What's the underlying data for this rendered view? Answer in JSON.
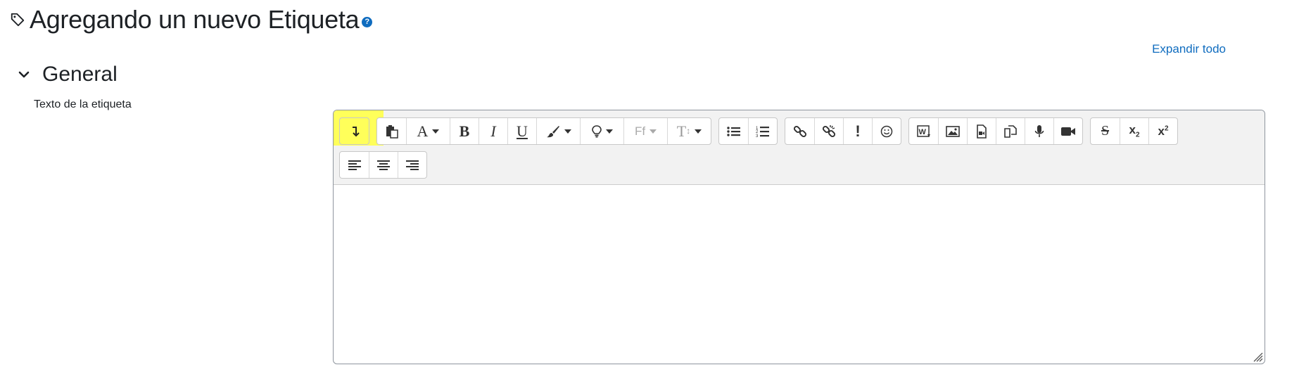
{
  "page": {
    "title": "Agregando un nuevo Etiqueta",
    "expand_all": "Expandir todo"
  },
  "section": {
    "title": "General"
  },
  "field": {
    "label": "Texto de la etiqueta",
    "value": ""
  },
  "toolbar": {
    "highlight_color": "#ffff5a",
    "row1": [
      {
        "name": "toolbar-toggle-button",
        "icon": "arrow-down-icon"
      },
      {
        "name": "paste-button",
        "icon": "clipboard-icon"
      },
      {
        "name": "font-family-button",
        "icon": "font-icon"
      },
      {
        "name": "bold-button",
        "icon": "bold-icon"
      },
      {
        "name": "italic-button",
        "icon": "italic-icon"
      },
      {
        "name": "underline-button",
        "icon": "underline-icon"
      },
      {
        "name": "text-color-button",
        "icon": "brush-icon"
      },
      {
        "name": "highlight-button",
        "icon": "lightbulb-icon"
      },
      {
        "name": "font-style-button",
        "icon": "font-style-icon"
      },
      {
        "name": "font-size-button",
        "icon": "font-size-icon"
      },
      {
        "name": "unordered-list-button",
        "icon": "bullet-list-icon"
      },
      {
        "name": "ordered-list-button",
        "icon": "numbered-list-icon"
      },
      {
        "name": "link-button",
        "icon": "link-icon"
      },
      {
        "name": "unlink-button",
        "icon": "unlink-icon"
      },
      {
        "name": "special-char-button",
        "icon": "exclamation-icon"
      },
      {
        "name": "emoji-button",
        "icon": "smiley-icon"
      },
      {
        "name": "paste-word-button",
        "icon": "word-icon"
      },
      {
        "name": "image-button",
        "icon": "image-icon"
      },
      {
        "name": "media-button",
        "icon": "media-file-icon"
      },
      {
        "name": "manage-files-button",
        "icon": "files-icon"
      },
      {
        "name": "record-audio-button",
        "icon": "microphone-icon"
      },
      {
        "name": "record-video-button",
        "icon": "video-camera-icon"
      },
      {
        "name": "strikethrough-button",
        "icon": "strikethrough-icon"
      },
      {
        "name": "subscript-button",
        "icon": "subscript-icon"
      },
      {
        "name": "superscript-button",
        "icon": "superscript-icon"
      }
    ],
    "row2": [
      {
        "name": "align-left-button",
        "icon": "align-left-icon"
      },
      {
        "name": "align-center-button",
        "icon": "align-center-icon"
      },
      {
        "name": "align-right-button",
        "icon": "align-right-icon"
      }
    ]
  }
}
